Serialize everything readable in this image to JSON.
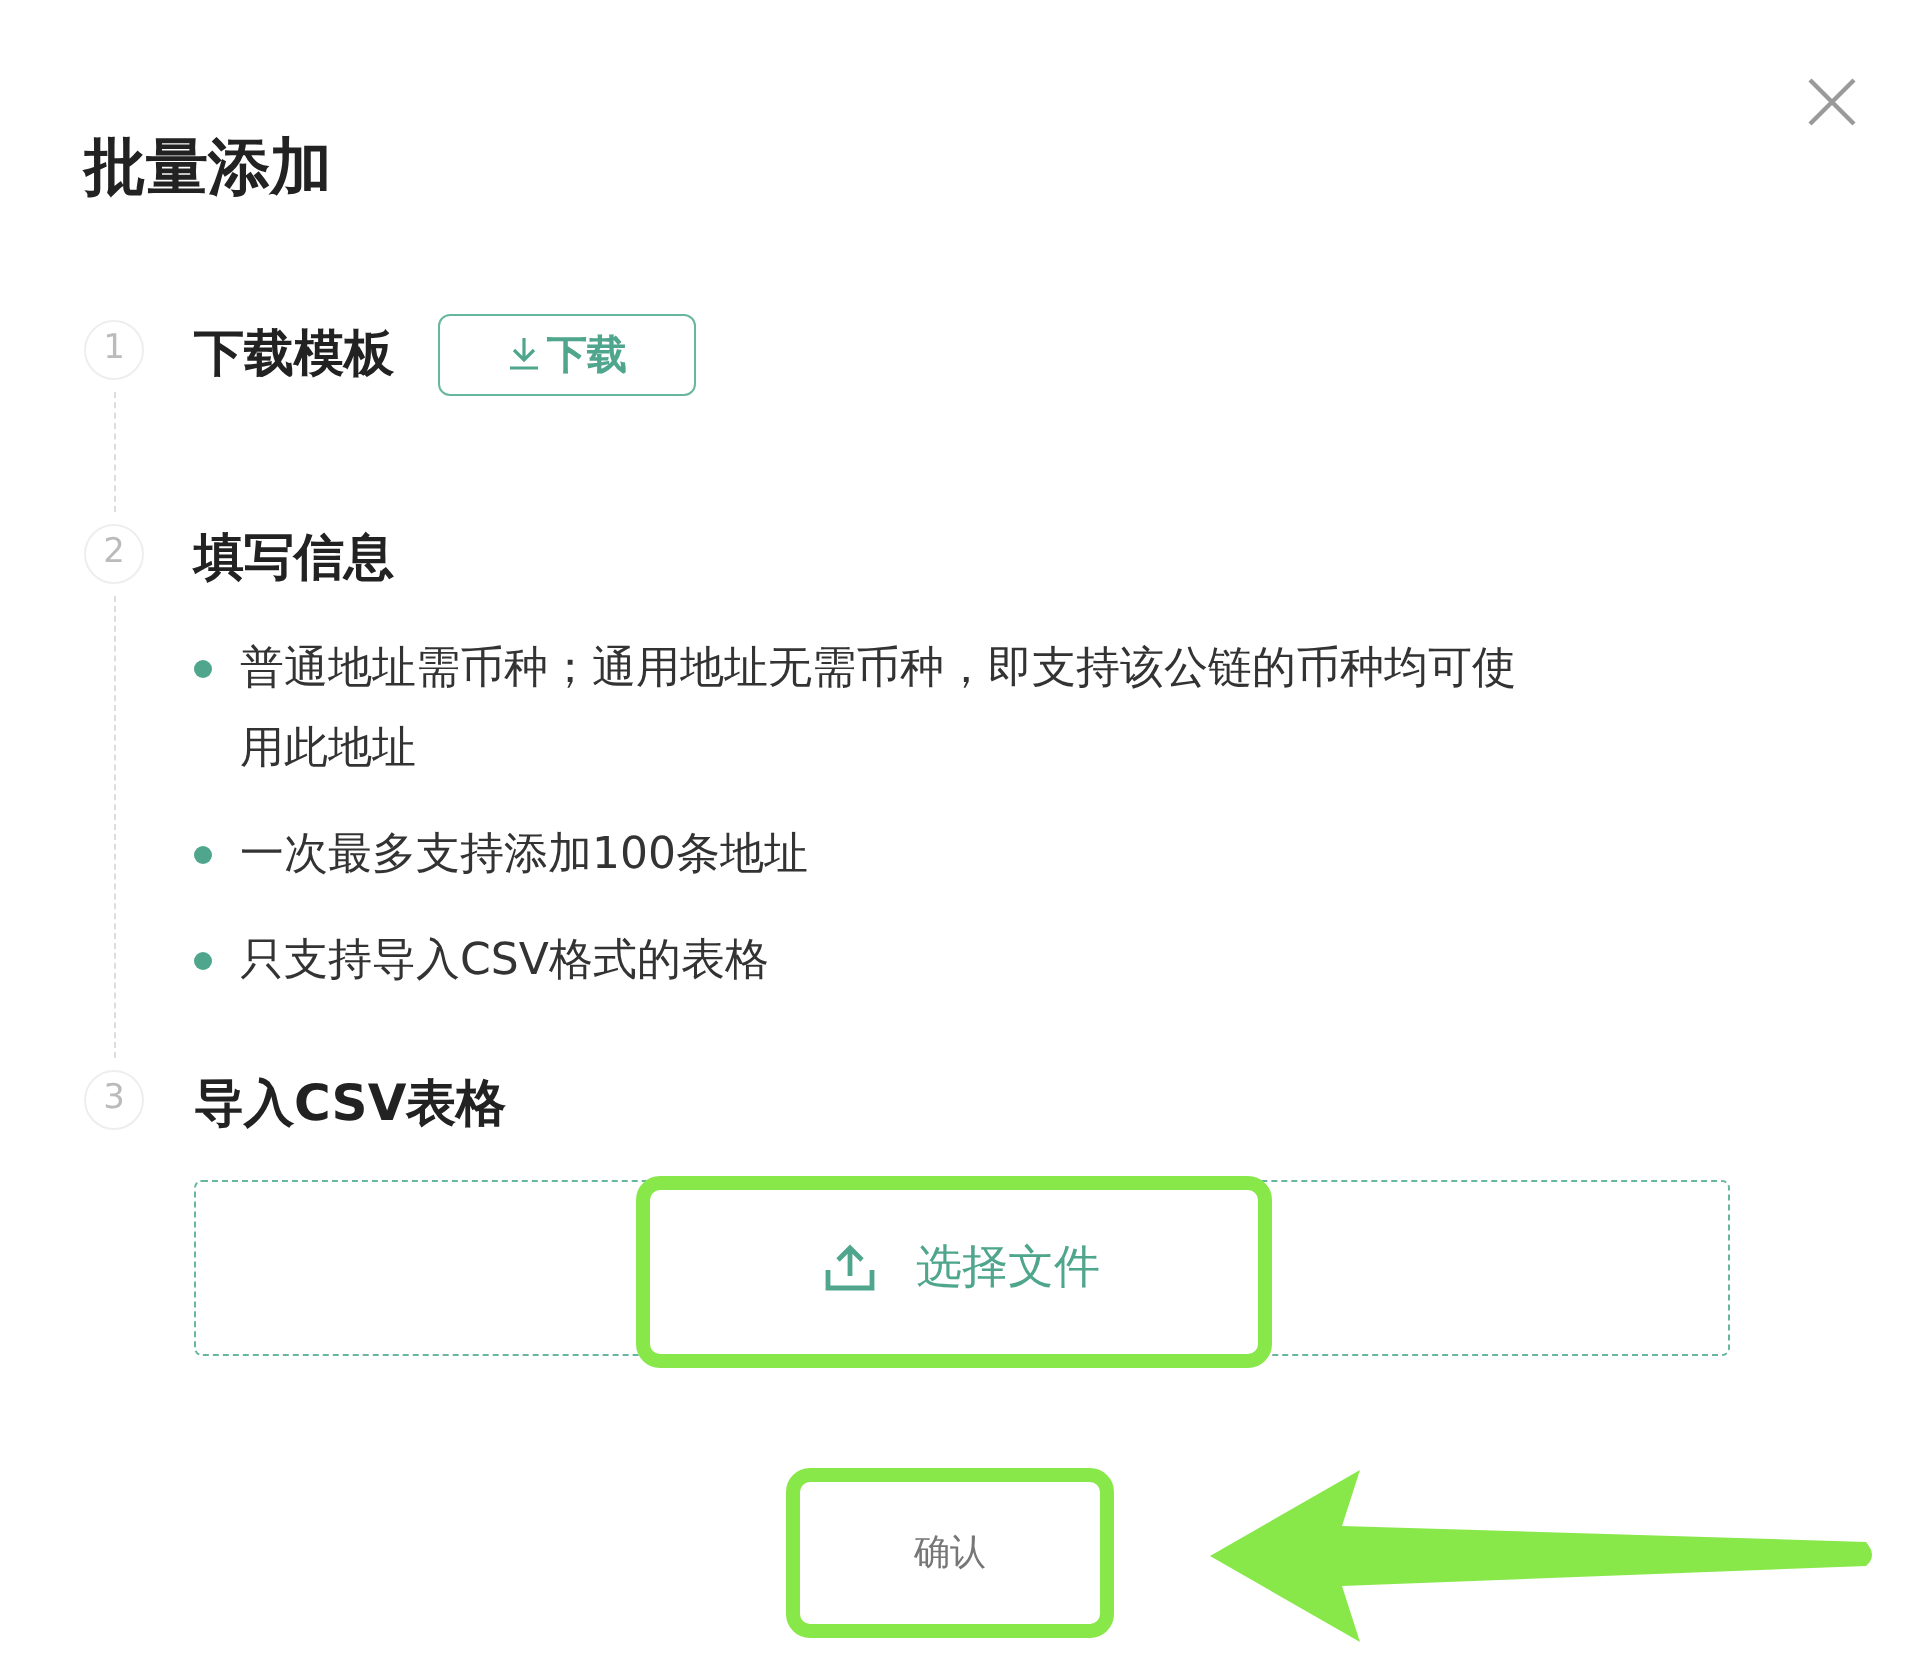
{
  "dialog": {
    "title": "批量添加"
  },
  "steps": [
    {
      "number": "1",
      "kind": "download",
      "title": "下载模板",
      "button": "下载"
    },
    {
      "number": "2",
      "kind": "list",
      "title": "填写信息",
      "bullets": [
        "普通地址需币种；通用地址无需币种，即支持该公链的币种均可使用此地址",
        "一次最多支持添加100条地址",
        "只支持导入CSV格式的表格"
      ]
    },
    {
      "number": "3",
      "kind": "upload",
      "title": "导入CSV表格",
      "button": "选择文件"
    }
  ],
  "confirm_button": "确认"
}
